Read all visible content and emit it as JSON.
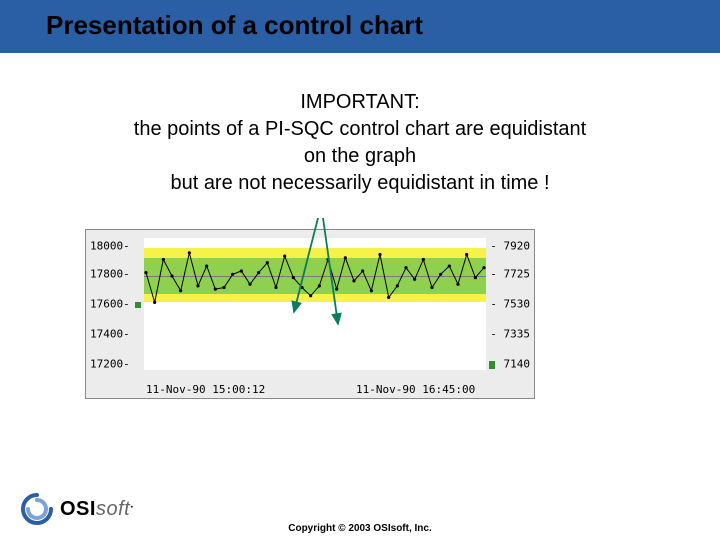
{
  "title": "Presentation of a control chart",
  "paragraph": {
    "l1": "IMPORTANT:",
    "l2": "the points of a PI-SQC control chart are equidistant",
    "l3": "on the graph",
    "l4": "but are not necessarily equidistant in time !"
  },
  "logo": {
    "osi": "OSI",
    "soft": "soft"
  },
  "copyright": "Copyright © 2003 OSIsoft, Inc.",
  "chart_data": {
    "type": "line",
    "title": "",
    "xlabel": "",
    "ylabel": "",
    "x_ticks": [
      "11-Nov-90 15:00:12",
      "11-Nov-90 16:45:00"
    ],
    "y_left": {
      "ticks": [
        17200,
        17400,
        17600,
        17800,
        18000
      ],
      "tick_labels": [
        "17200-",
        "17400-",
        "17600-",
        "17800-",
        "18000-"
      ],
      "lim": [
        17200,
        18000
      ]
    },
    "y_right": {
      "ticks": [
        7140,
        7335,
        7530,
        7725,
        7920
      ],
      "tick_labels": [
        "- 7140",
        "- 7335",
        "- 7530",
        "- 7725",
        "- 7920"
      ],
      "lim": [
        7140,
        7920
      ]
    },
    "control_bands": [
      {
        "from": 17880,
        "to": 17940,
        "color": "#f6f24a"
      },
      {
        "from": 17660,
        "to": 17880,
        "color": "#8fd14f"
      },
      {
        "from": 17610,
        "to": 17660,
        "color": "#f6f24a"
      }
    ],
    "center_line": 17770,
    "series": [
      {
        "name": "main",
        "axis": "left",
        "color": "#000000",
        "values": [
          17790,
          17610,
          17870,
          17770,
          17680,
          17910,
          17710,
          17830,
          17690,
          17700,
          17780,
          17800,
          17720,
          17790,
          17850,
          17700,
          17890,
          17760,
          17700,
          17650,
          17710,
          17870,
          17690,
          17880,
          17740,
          17800,
          17680,
          17900,
          17640,
          17710,
          17820,
          17750,
          17870,
          17700,
          17780,
          17830,
          17720,
          17900,
          17760,
          17820
        ]
      }
    ],
    "callout_indices": [
      17,
      22
    ]
  }
}
